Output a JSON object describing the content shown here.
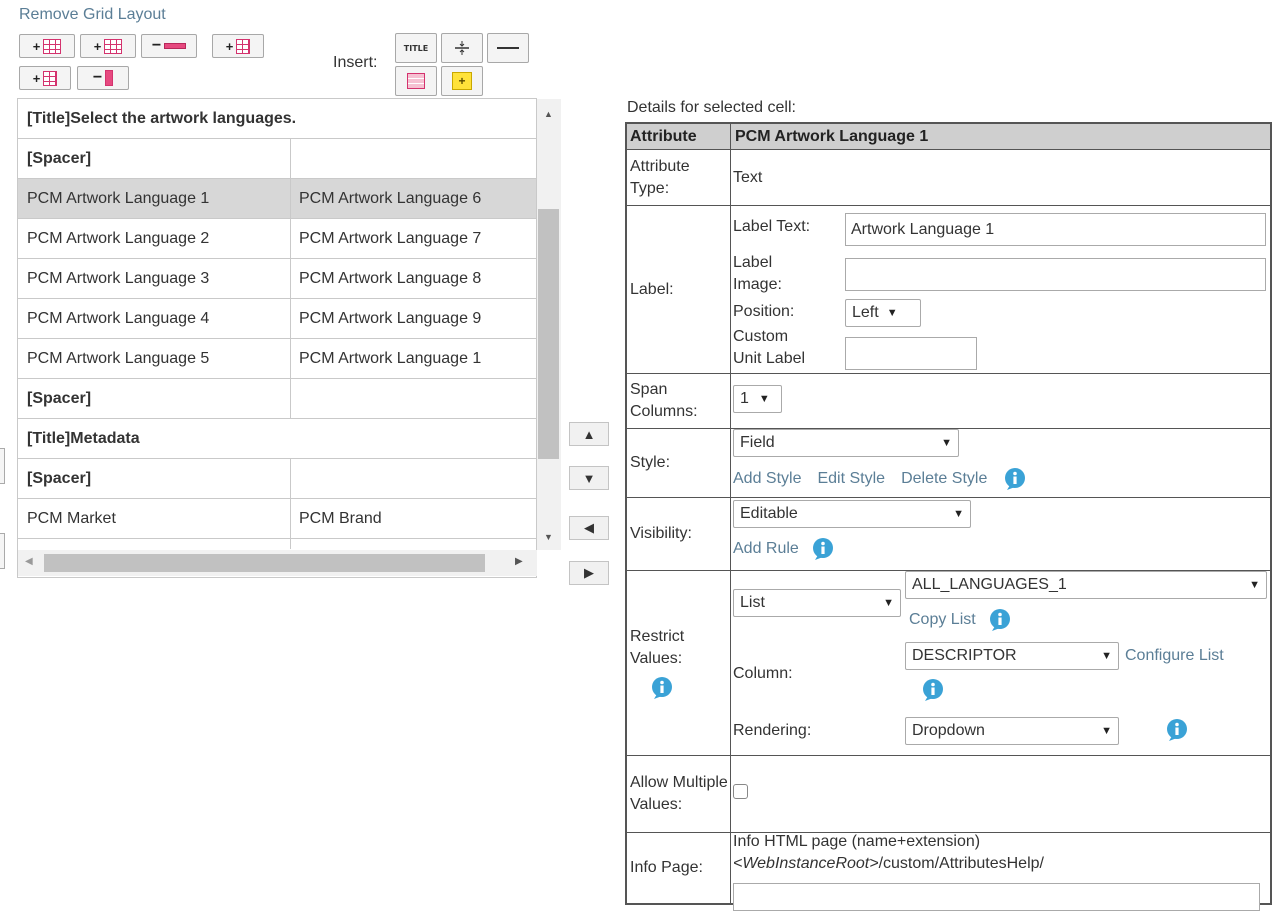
{
  "toolbar": {
    "remove_grid_layout": "Remove Grid Layout",
    "insert_label": "Insert:",
    "title_icon_text": "TITLE"
  },
  "grid": {
    "rows": [
      {
        "type": "title",
        "c1": "[Title]Select the artwork languages.",
        "c2": ""
      },
      {
        "type": "spacer",
        "c1": "[Spacer]",
        "c2": ""
      },
      {
        "type": "cell",
        "c1": "PCM Artwork Language 1",
        "c2": "PCM Artwork Language 6",
        "selected": true
      },
      {
        "type": "cell",
        "c1": "PCM Artwork Language 2",
        "c2": "PCM Artwork Language 7"
      },
      {
        "type": "cell",
        "c1": "PCM Artwork Language 3",
        "c2": "PCM Artwork Language 8"
      },
      {
        "type": "cell",
        "c1": "PCM Artwork Language 4",
        "c2": "PCM Artwork Language 9"
      },
      {
        "type": "cell",
        "c1": "PCM Artwork Language 5",
        "c2": "PCM Artwork Language 1"
      },
      {
        "type": "spacer",
        "c1": "[Spacer]",
        "c2": ""
      },
      {
        "type": "title",
        "c1": "[Title]Metadata",
        "c2": ""
      },
      {
        "type": "spacer",
        "c1": "[Spacer]",
        "c2": ""
      },
      {
        "type": "cell",
        "c1": "PCM Market",
        "c2": "PCM Brand"
      }
    ]
  },
  "details": {
    "heading": "Details for selected cell:",
    "header_attr": "Attribute",
    "header_value": "PCM Artwork Language 1",
    "attribute_type_label": "Attribute Type:",
    "attribute_type_value": "Text",
    "label_label": "Label:",
    "label_text_label": "Label Text:",
    "label_text_value": "Artwork Language 1",
    "label_image_label": "Label Image:",
    "label_image_value": "",
    "position_label": "Position:",
    "position_value": "Left",
    "custom_unit_label": "Custom Unit Label",
    "custom_unit_value": "",
    "span_columns_label": "Span Columns:",
    "span_columns_value": "1",
    "style_label": "Style:",
    "style_value": "Field",
    "add_style": "Add Style",
    "edit_style": "Edit Style",
    "delete_style": "Delete Style",
    "visibility_label": "Visibility:",
    "visibility_value": "Editable",
    "add_rule": "Add Rule",
    "restrict_label": "Restrict Values:",
    "restrict_type": "List",
    "restrict_list": "ALL_LANGUAGES_1",
    "copy_list": "Copy List",
    "column_label": "Column:",
    "column_value": "DESCRIPTOR",
    "configure_list": "Configure List",
    "rendering_label": "Rendering:",
    "rendering_value": "Dropdown",
    "allow_multiple_label": "Allow Multiple Values:",
    "info_page_label": "Info Page:",
    "info_page_hint": "Info HTML page (name+extension)",
    "info_page_root": "<WebInstanceRoot>",
    "info_page_path": "/custom/AttributesHelp/"
  },
  "colors": {
    "accent_pink": "#d4336e",
    "info_blue": "#3aa2d6",
    "link": "#5b7e96"
  }
}
